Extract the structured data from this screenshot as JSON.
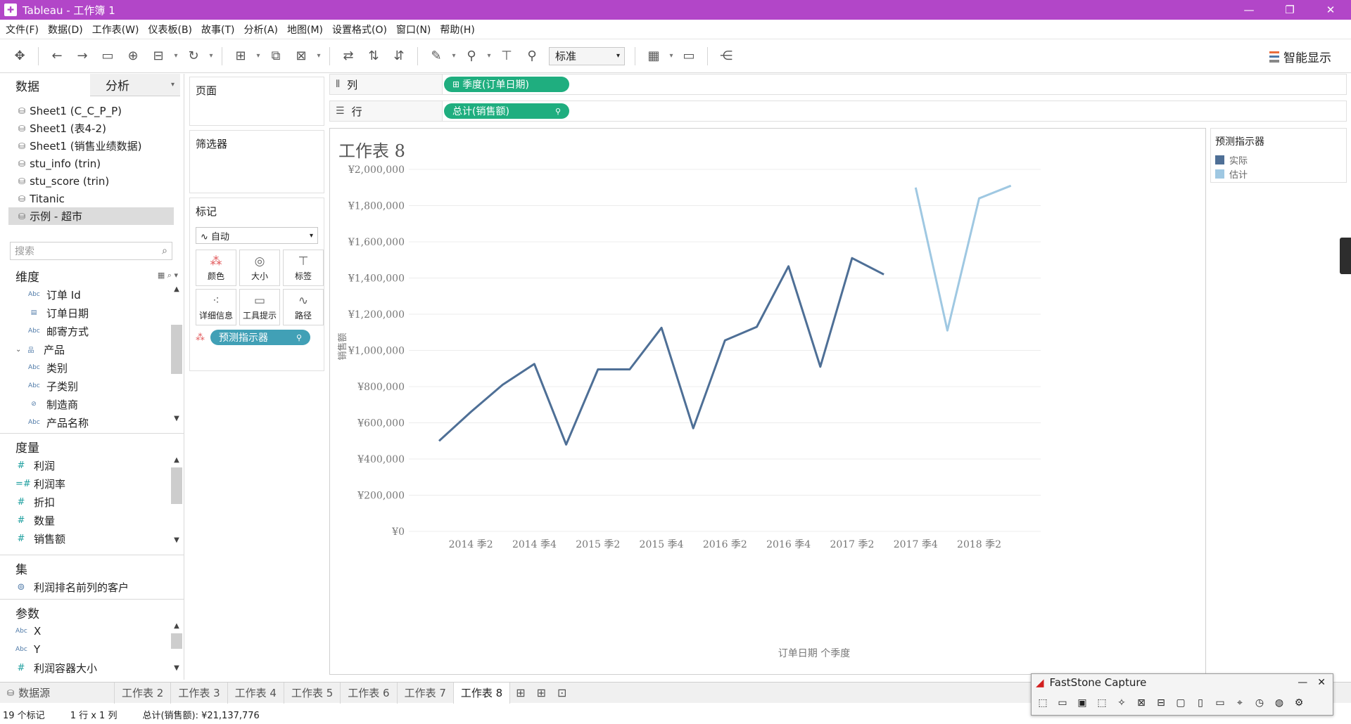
{
  "window": {
    "title": "Tableau - 工作簿 1",
    "min": "—",
    "restore": "❐",
    "close": "✕"
  },
  "menu": [
    "文件(F)",
    "数据(D)",
    "工作表(W)",
    "仪表板(B)",
    "故事(T)",
    "分析(A)",
    "地图(M)",
    "设置格式(O)",
    "窗口(N)",
    "帮助(H)"
  ],
  "toolbar": {
    "fit_value": "标准",
    "smart_show": "智能显示"
  },
  "left": {
    "tab_data": "数据",
    "tab_analysis": "分析",
    "datasources": [
      "Sheet1 (C_C_P_P)",
      "Sheet1 (表4-2)",
      "Sheet1 (销售业绩数据)",
      "stu_info (trin)",
      "stu_score (trin)",
      "Titanic",
      "示例 - 超市"
    ],
    "search_placeholder": "搜索",
    "dimensions_title": "维度",
    "dimensions": [
      {
        "label": "订单 Id",
        "icon": "Abc"
      },
      {
        "label": "订单日期",
        "icon": "▤"
      },
      {
        "label": "邮寄方式",
        "icon": "Abc"
      },
      {
        "label": "产品",
        "icon": "品"
      },
      {
        "label": "类别",
        "icon": "Abc"
      },
      {
        "label": "子类别",
        "icon": "Abc"
      },
      {
        "label": "制造商",
        "icon": "⊘"
      },
      {
        "label": "产品名称",
        "icon": "Abc"
      }
    ],
    "measures_title": "度量",
    "measures": [
      "利润",
      "利润率",
      "折扣",
      "数量",
      "销售额"
    ],
    "sets_title": "集",
    "sets": [
      "利润排名前列的客户"
    ],
    "params_title": "参数",
    "params": [
      {
        "label": "X",
        "icon": "Abc"
      },
      {
        "label": "Y",
        "icon": "Abc"
      },
      {
        "label": "利润容器大小",
        "icon": "#"
      }
    ]
  },
  "cards": {
    "pages": "页面",
    "filters": "筛选器",
    "marks": "标记",
    "marks_type": "自动",
    "mark_buttons": [
      "颜色",
      "大小",
      "标签",
      "详细信息",
      "工具提示",
      "路径"
    ],
    "marks_pill": "预测指示器"
  },
  "shelves": {
    "columns_label": "列",
    "columns_pill": "季度(订单日期)",
    "rows_label": "行",
    "rows_pill": "总计(销售额)"
  },
  "legend": {
    "title": "预测指示器",
    "items": [
      {
        "label": "实际",
        "color": "#4e6f96"
      },
      {
        "label": "估计",
        "color": "#9fc8e2"
      }
    ]
  },
  "sheets": [
    "工作表 2",
    "工作表 3",
    "工作表 4",
    "工作表 5",
    "工作表 6",
    "工作表 7",
    "工作表 8"
  ],
  "datasource_tab": "数据源",
  "status": {
    "marks": "19 个标记",
    "shape": "1 行 x 1 列",
    "sum": "总计(销售额): ¥21,137,776"
  },
  "faststone": {
    "title": "FastStone Capture"
  },
  "chart_data": {
    "type": "line",
    "title": "工作表 8",
    "xlabel": "订单日期 个季度",
    "ylabel": "销售额",
    "ylim": [
      0,
      2000000
    ],
    "yticks": [
      "¥0",
      "¥200,000",
      "¥400,000",
      "¥600,000",
      "¥800,000",
      "¥1,000,000",
      "¥1,200,000",
      "¥1,400,000",
      "¥1,600,000",
      "¥1,800,000",
      "¥2,000,000"
    ],
    "xtick_labels": [
      "2014 季2",
      "2014 季4",
      "2015 季2",
      "2015 季4",
      "2016 季2",
      "2016 季4",
      "2017 季2",
      "2017 季4",
      "2018 季2"
    ],
    "categories": [
      "2014 季1",
      "2014 季2",
      "2014 季3",
      "2014 季4",
      "2015 季1",
      "2015 季2",
      "2015 季3",
      "2015 季4",
      "2016 季1",
      "2016 季2",
      "2016 季3",
      "2016 季4",
      "2017 季1",
      "2017 季2",
      "2017 季3",
      "2017 季4",
      "2018 季1",
      "2018 季2",
      "2018 季3"
    ],
    "series": [
      {
        "name": "实际",
        "color": "#4e6f96",
        "start": 0,
        "values": [
          500000,
          660000,
          810000,
          925000,
          480000,
          895000,
          895000,
          1125000,
          570000,
          1055000,
          1130000,
          1465000,
          910000,
          1510000,
          1420000
        ]
      },
      {
        "name": "估计",
        "color": "#9fc8e2",
        "start": 15,
        "values": [
          1900000,
          1110000,
          1840000,
          1910000
        ]
      }
    ]
  }
}
